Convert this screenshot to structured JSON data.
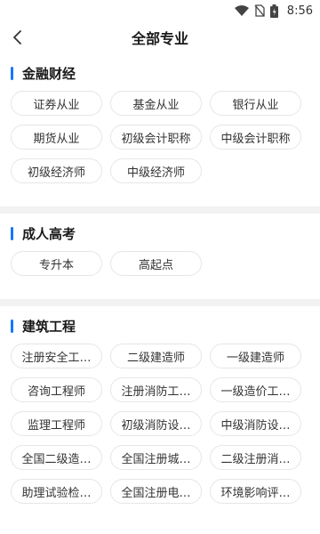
{
  "status_bar": {
    "time": "8:56"
  },
  "header": {
    "title": "全部专业"
  },
  "sections": [
    {
      "title": "金融财经",
      "items": [
        "证券从业",
        "基金从业",
        "银行从业",
        "期货从业",
        "初级会计职称",
        "中级会计职称",
        "初级经济师",
        "中级经济师"
      ]
    },
    {
      "title": "成人高考",
      "items": [
        "专升本",
        "高起点"
      ]
    },
    {
      "title": "建筑工程",
      "items": [
        "注册安全工…",
        "二级建造师",
        "一级建造师",
        "咨询工程师",
        "注册消防工…",
        "一级造价工…",
        "监理工程师",
        "初级消防设…",
        "中级消防设…",
        "全国二级造…",
        "全国注册城…",
        "二级注册消…",
        "助理试验检…",
        "全国注册电…",
        "环境影响评…"
      ]
    }
  ],
  "colors": {
    "accent": "#1677ff",
    "divider": "#f2f2f2",
    "chip_border": "#e6e6e6"
  }
}
